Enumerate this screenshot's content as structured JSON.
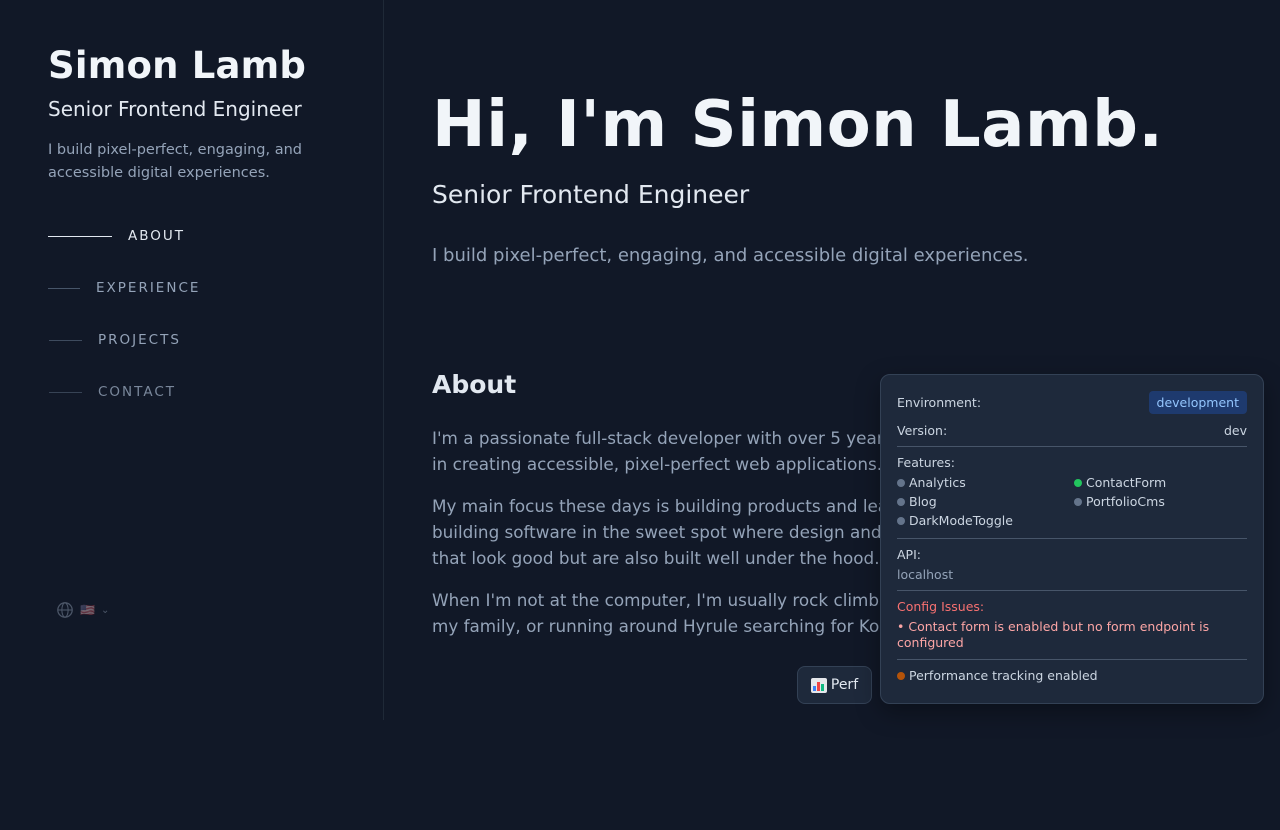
{
  "sidebar": {
    "name": "Simon Lamb",
    "role": "Senior Frontend Engineer",
    "description": "I build pixel-perfect, engaging, and accessible digital experiences.",
    "nav": [
      {
        "label": "ABOUT",
        "active": true
      },
      {
        "label": "EXPERIENCE",
        "active": false
      },
      {
        "label": "PROJECTS",
        "active": false
      },
      {
        "label": "CONTACT",
        "active": false
      }
    ],
    "language": {
      "flag": "🇺🇸",
      "icon": "globe-icon"
    }
  },
  "hero": {
    "title": "Hi, I'm Simon Lamb.",
    "role": "Senior Frontend Engineer",
    "description": "I build pixel-perfect, engaging, and accessible digital experiences."
  },
  "about": {
    "heading": "About",
    "paragraphs": [
      "I'm a passionate full-stack developer with over 5 years of experience. I specialize in creating accessible, pixel-perfect web applications.",
      "My main focus these days is building products and leading projects. I enjoy building software in the sweet spot where design and engineering meet — things that look good but are also built well under the hood.",
      "When I'm not at the computer, I'm usually rock climbing, reading, hanging out with my family, or running around Hyrule searching for Korok seeds."
    ]
  },
  "perf_button": {
    "label": "Perf",
    "icon": "bar-chart-icon"
  },
  "debug_panel": {
    "environment_label": "Environment:",
    "environment_value": "development",
    "version_label": "Version:",
    "version_value": "dev",
    "features_label": "Features:",
    "features": [
      {
        "name": "Analytics",
        "enabled": false
      },
      {
        "name": "ContactForm",
        "enabled": true
      },
      {
        "name": "Blog",
        "enabled": false
      },
      {
        "name": "PortfolioCms",
        "enabled": false
      },
      {
        "name": "DarkModeToggle",
        "enabled": false
      }
    ],
    "api_label": "API:",
    "api_value": "localhost",
    "issues_label": "Config Issues:",
    "issues": [
      "• Contact form is enabled but no form endpoint is configured"
    ],
    "perf_status": "Performance tracking enabled"
  },
  "colors": {
    "background": "#111827",
    "enabled_dot": "#22c55e",
    "disabled_dot": "#64748b",
    "perf_dot": "#b45309",
    "env_badge_bg": "#1e3a6e",
    "issue_text": "#f87171"
  }
}
